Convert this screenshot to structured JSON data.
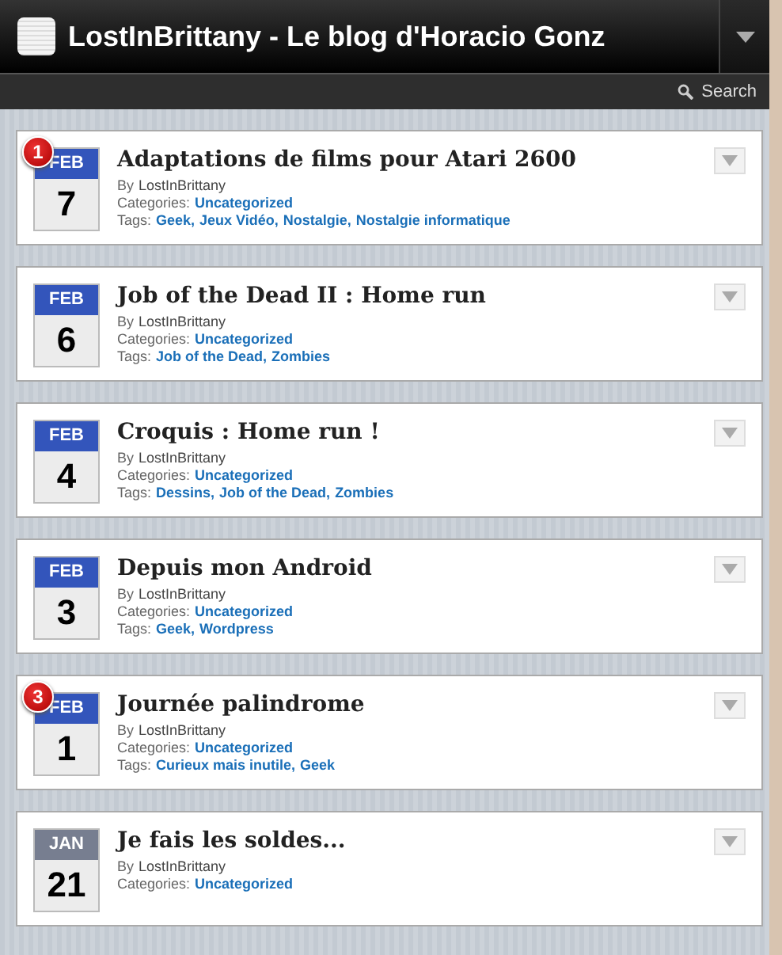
{
  "header": {
    "title": "LostInBrittany - Le blog d'Horacio Gonz"
  },
  "toolbar": {
    "search": "Search"
  },
  "posts": [
    {
      "badge": "1",
      "month": "FEB",
      "color": "#3355bb",
      "day": "7",
      "title": "Adaptations de films pour Atari 2600",
      "author_label": "By",
      "author": "LostInBrittany",
      "categories_label": "Categories:",
      "categories": [
        "Uncategorized"
      ],
      "tags_label": "Tags:",
      "tags": [
        "Geek,",
        "Jeux Vidéo,",
        "Nostalgie,",
        "Nostalgie informatique"
      ]
    },
    {
      "month": "FEB",
      "color": "#3355bb",
      "day": "6",
      "title": "Job of the Dead II : Home run",
      "author_label": "By",
      "author": "LostInBrittany",
      "categories_label": "Categories:",
      "categories": [
        "Uncategorized"
      ],
      "tags_label": "Tags:",
      "tags": [
        "Job of the Dead,",
        "Zombies"
      ]
    },
    {
      "month": "FEB",
      "color": "#3355bb",
      "day": "4",
      "title": "Croquis : Home run !",
      "author_label": "By",
      "author": "LostInBrittany",
      "categories_label": "Categories:",
      "categories": [
        "Uncategorized"
      ],
      "tags_label": "Tags:",
      "tags": [
        "Dessins,",
        "Job of the Dead,",
        "Zombies"
      ]
    },
    {
      "month": "FEB",
      "color": "#3355bb",
      "day": "3",
      "title": "Depuis mon Android",
      "author_label": "By",
      "author": "LostInBrittany",
      "categories_label": "Categories:",
      "categories": [
        "Uncategorized"
      ],
      "tags_label": "Tags:",
      "tags": [
        "Geek,",
        "Wordpress"
      ]
    },
    {
      "badge": "3",
      "month": "FEB",
      "color": "#3355bb",
      "day": "1",
      "title": "Journée palindrome",
      "author_label": "By",
      "author": "LostInBrittany",
      "categories_label": "Categories:",
      "categories": [
        "Uncategorized"
      ],
      "tags_label": "Tags:",
      "tags": [
        "Curieux mais inutile,",
        "Geek"
      ]
    },
    {
      "month": "JAN",
      "color": "#777e90",
      "day": "21",
      "title": "Je fais les soldes...",
      "author_label": "By",
      "author": "LostInBrittany",
      "categories_label": "Categories:",
      "categories": [
        "Uncategorized"
      ]
    }
  ]
}
